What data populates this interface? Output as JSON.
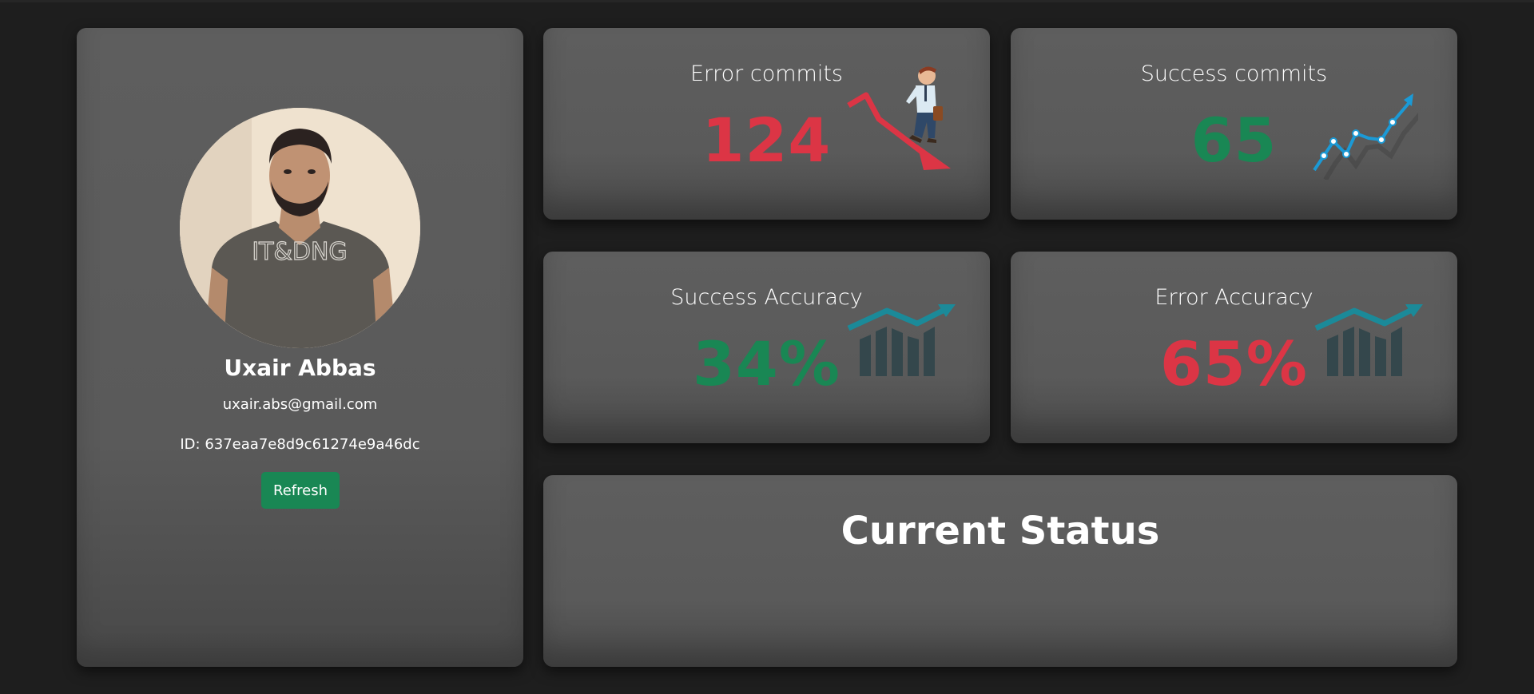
{
  "profile": {
    "name": "Uxair Abbas",
    "email": "uxair.abs@gmail.com",
    "id_text": "ID: 637eaa7e8d9c61274e9a46dc",
    "refresh_label": "Refresh",
    "shirt_text": "IT&DNG"
  },
  "stats": {
    "error_commits": {
      "title": "Error commits",
      "value": "124",
      "color": "#dc3545",
      "icon": "falling-chart-man-icon"
    },
    "success_commits": {
      "title": "Success commits",
      "value": "65",
      "color": "#198754",
      "icon": "rising-line-chart-icon"
    },
    "success_accuracy": {
      "title": "Success Accuracy",
      "value": "34%",
      "color": "#198754",
      "icon": "growth-bar-chart-icon"
    },
    "error_accuracy": {
      "title": "Error Accuracy",
      "value": "65%",
      "color": "#dc3545",
      "icon": "growth-bar-chart-icon"
    }
  },
  "status": {
    "title": "Current Status"
  },
  "colors": {
    "background": "#1e1e1e",
    "card": "#5e5e5e",
    "success": "#198754",
    "danger": "#dc3545",
    "accent_teal": "#1b8a99"
  }
}
